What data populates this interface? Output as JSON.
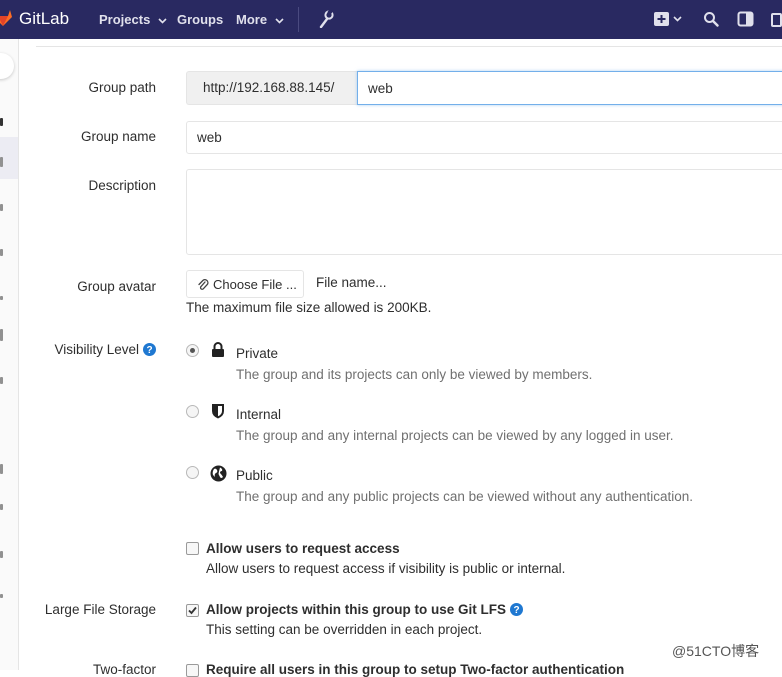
{
  "navbar": {
    "brand": "GitLab",
    "projects": "Projects",
    "groups": "Groups",
    "more": "More",
    "bg_color": "#292961",
    "icons": [
      "admin-wrench-icon",
      "new-plus-icon",
      "search-icon",
      "todo-sidebar-icon"
    ]
  },
  "form": {
    "group_path": {
      "label": "Group path",
      "prefix": "http://192.168.88.145/",
      "value": "web"
    },
    "group_name": {
      "label": "Group name",
      "value": "web"
    },
    "description": {
      "label": "Description",
      "value": ""
    },
    "group_avatar": {
      "label": "Group avatar",
      "button": "Choose File ...",
      "file_name": "File name...",
      "hint": "The maximum file size allowed is 200KB."
    },
    "visibility": {
      "label": "Visibility Level",
      "options": [
        {
          "title": "Private",
          "desc": "The group and its projects can only be viewed by members.",
          "checked": true,
          "icon": "lock-icon"
        },
        {
          "title": "Internal",
          "desc": "The group and any internal projects can be viewed by any logged in user.",
          "checked": false,
          "icon": "shield-icon"
        },
        {
          "title": "Public",
          "desc": "The group and any public projects can be viewed without any authentication.",
          "checked": false,
          "icon": "globe-icon"
        }
      ]
    },
    "request_access": {
      "title": "Allow users to request access",
      "desc": "Allow users to request access if visibility is public or internal.",
      "checked": false
    },
    "lfs": {
      "label": "Large File Storage",
      "title": "Allow projects within this group to use Git LFS",
      "desc": "This setting can be overridden in each project.",
      "checked": true
    },
    "two_factor": {
      "label": "Two-factor",
      "title": "Require all users in this group to setup Two-factor authentication",
      "checked": false
    }
  },
  "watermark": "@51CTO博客",
  "colors": {
    "accent": "#1f78d1",
    "focus_border": "#73afea"
  }
}
